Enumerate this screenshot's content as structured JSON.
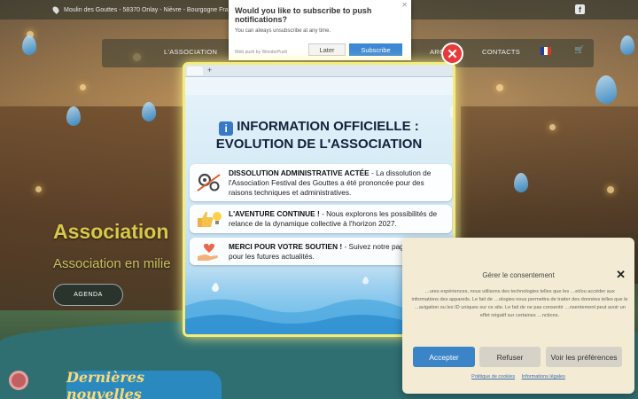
{
  "topbar": {
    "address": "Moulin des Gouttes - 58370 Onlay - Nièvre - Bourgogne Franch",
    "facebook_icon": "facebook-icon"
  },
  "nav": {
    "items": [
      "L'ASSOCIATION",
      "ARCHI",
      "CONTACTS"
    ],
    "language": "fr-flag-icon",
    "cart_icon": "cart-icon"
  },
  "hero": {
    "title": "Association",
    "subtitle": "Association en milie",
    "agenda_label": "AGENDA"
  },
  "news": {
    "title": "Dernières nouvelles"
  },
  "push_prompt": {
    "title": "Would you like to subscribe to push notifications?",
    "description": "You can always unsubscribe at any time.",
    "powered_by": "Web push by WonderPush",
    "later_label": "Later",
    "subscribe_label": "Subscribe"
  },
  "modal": {
    "title_line1": "INFORMATION OFFICIELLE :",
    "title_line2": "EVOLUTION DE L'ASSOCIATION",
    "info_icon": "i",
    "cards": [
      {
        "icon": "gears-icon",
        "heading": "DISSOLUTION ADMINISTRATIVE ACTÉE",
        "text": " - La dissolution de l'Association Festival des Gouttes a été prononcée pour des raisons techniques et administratives."
      },
      {
        "icon": "thumbs-up-bulb-icon",
        "heading": "L'AVENTURE CONTINUE !",
        "text": " - Nous explorons les possibilités de relance de la dynamique collective à l'horizon 2027."
      },
      {
        "icon": "heart-hand-icon",
        "heading": "MERCI POUR VOTRE SOUTIEN !",
        "text": " - Suivez notre page Facebook pour les futures actualités."
      }
    ]
  },
  "consent": {
    "title": "Gérer le consentement",
    "text": "…ures expériences, nous utilisons des technologies telles que les …et/ou accéder aux informations des appareils. Le fait de …ologies nous permettra de traiter des données telles que le …avigation ou les ID uniques sur ce site. Le fait de ne pas consentir …nsentement peut avoir un effet négatif sur certaines …nctions.",
    "accept_label": "Accepter",
    "refuse_label": "Refuser",
    "prefs_label": "Voir les préférences",
    "cookie_policy": "Politique de cookies",
    "legal": "Informations légales"
  },
  "colors": {
    "accent": "#3b84c8",
    "modal_glow": "#f5ec7a",
    "close_red": "#e83a3a",
    "title_gold": "#d8c84a"
  }
}
